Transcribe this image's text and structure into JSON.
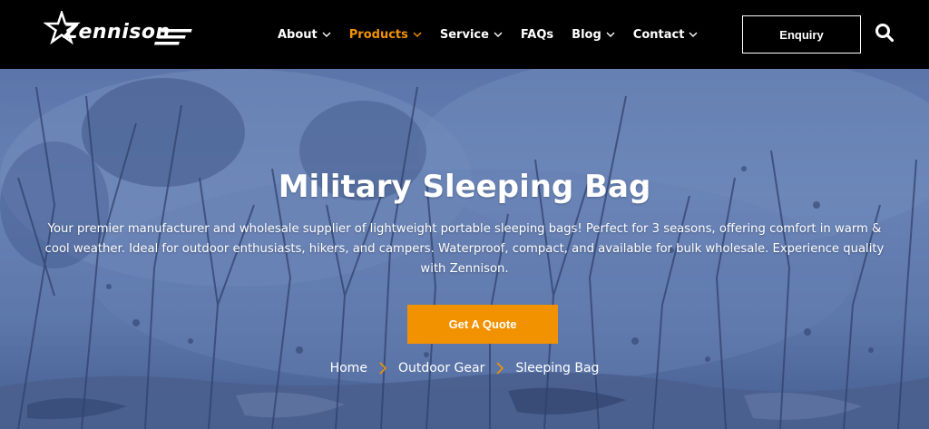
{
  "header": {
    "logo_text": "Zennison",
    "nav": [
      {
        "label": "About",
        "has_dropdown": true,
        "active": false
      },
      {
        "label": "Products",
        "has_dropdown": true,
        "active": true
      },
      {
        "label": "Service",
        "has_dropdown": true,
        "active": false
      },
      {
        "label": "FAQs",
        "has_dropdown": false,
        "active": false
      },
      {
        "label": "Blog",
        "has_dropdown": true,
        "active": false
      },
      {
        "label": "Contact",
        "has_dropdown": true,
        "active": false
      }
    ],
    "enquiry_label": "Enquiry",
    "search_icon": "search-icon"
  },
  "hero": {
    "title": "Military Sleeping Bag",
    "description": "Your premier manufacturer and wholesale supplier of lightweight portable sleeping bags! Perfect for 3 seasons, offering comfort in warm & cool weather. Ideal for outdoor enthusiasts, hikers, and campers. Waterproof, compact, and available for bulk wholesale. Experience quality with Zennison.",
    "cta_label": "Get A Quote"
  },
  "breadcrumb": [
    {
      "label": "Home",
      "current": false
    },
    {
      "label": "Outdoor Gear",
      "current": false
    },
    {
      "label": "Sleeping Bag",
      "current": true
    }
  ],
  "colors": {
    "accent": "#f39200",
    "header_bg": "#000000",
    "text_light": "#ffffff"
  }
}
